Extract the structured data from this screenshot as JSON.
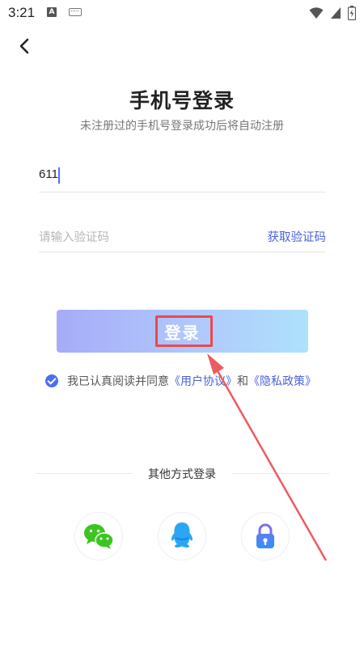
{
  "status_bar": {
    "time": "3:21",
    "notification_icon": "a-icon",
    "keyboard_icon": "keyboard-icon",
    "wifi_icon": "wifi-icon",
    "signal_icon": "signal-icon",
    "battery_icon": "battery-icon"
  },
  "nav": {
    "back_icon": "back-arrow-icon"
  },
  "header": {
    "title": "手机号登录",
    "subtitle": "未注册过的手机号登录成功后将自动注册"
  },
  "form": {
    "phone_value": "611",
    "code_placeholder": "请输入验证码",
    "get_code_label": "获取验证码",
    "login_label": "登录"
  },
  "agreement": {
    "checked": true,
    "prefix": "我已认真阅读并同意",
    "user_agreement": "《用户协议》",
    "conjunction": "和",
    "privacy_policy": "《隐私政策》"
  },
  "other_login": {
    "label": "其他方式登录",
    "options": [
      "wechat-icon",
      "qq-icon",
      "lock-icon"
    ]
  },
  "colors": {
    "accent": "#4a62d8",
    "highlight": "#e84a4f",
    "wechat": "#3cc51f",
    "qq": "#2aa6f5"
  }
}
